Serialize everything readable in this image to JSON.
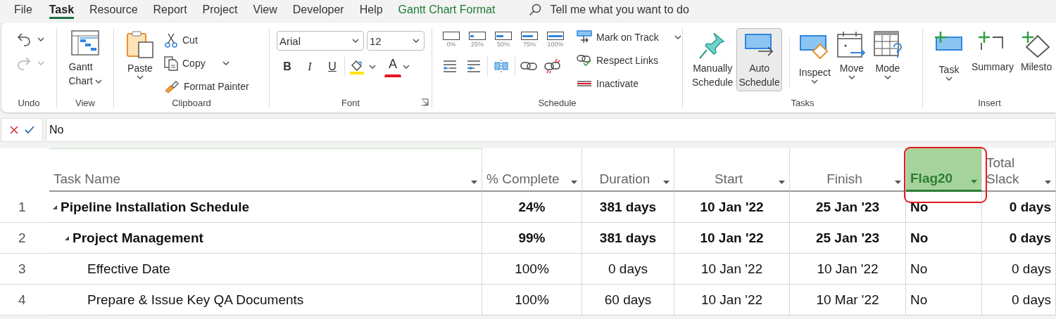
{
  "menu_tabs": [
    {
      "label": "File",
      "selected": false,
      "kind": "tab"
    },
    {
      "label": "Task",
      "selected": true,
      "kind": "tab"
    },
    {
      "label": "Resource",
      "selected": false,
      "kind": "tab"
    },
    {
      "label": "Report",
      "selected": false,
      "kind": "tab"
    },
    {
      "label": "Project",
      "selected": false,
      "kind": "tab"
    },
    {
      "label": "View",
      "selected": false,
      "kind": "tab"
    },
    {
      "label": "Developer",
      "selected": false,
      "kind": "tab"
    },
    {
      "label": "Help",
      "selected": false,
      "kind": "tab"
    },
    {
      "label": "Gantt Chart Format",
      "selected": false,
      "kind": "contextual"
    }
  ],
  "tell_me": {
    "placeholder": "Tell me what you want to do"
  },
  "ribbon": {
    "undo_group": {
      "label": "Undo",
      "undo": {
        "disabled": false
      },
      "redo": {
        "disabled": true
      }
    },
    "view_group": {
      "label": "View",
      "gantt_chart": "Gantt Chart"
    },
    "clipboard_group": {
      "label": "Clipboard",
      "paste": "Paste",
      "cut": "Cut",
      "copy": "Copy",
      "format_painter": "Format Painter"
    },
    "font_group": {
      "label": "Font",
      "font_name": "Arial",
      "font_size": "12",
      "bold": "B",
      "italic": "I",
      "underline": "U",
      "font_color": "A"
    },
    "schedule_group": {
      "label": "Schedule",
      "percent_buttons": [
        {
          "label": "0%"
        },
        {
          "label": "25%"
        },
        {
          "label": "50%"
        },
        {
          "label": "75%"
        },
        {
          "label": "100%"
        }
      ],
      "mark_on_track": "Mark on Track",
      "respect_links": "Respect Links",
      "inactivate": "Inactivate"
    },
    "tasks_group": {
      "label": "Tasks",
      "mode_buttons": [
        {
          "label": "Manually Schedule",
          "selected": false
        },
        {
          "label": "Auto Schedule",
          "selected": true
        }
      ],
      "inspect": "Inspect",
      "move": "Move",
      "mode": "Mode"
    },
    "insert_group": {
      "label": "Insert",
      "task": "Task",
      "summary": "Summary",
      "milestone": "Milesto"
    }
  },
  "formula_bar": {
    "value": "No"
  },
  "table": {
    "columns": [
      {
        "label": "Task Name",
        "selected": false,
        "annotated": false
      },
      {
        "label": "% Complete",
        "selected": false,
        "annotated": false
      },
      {
        "label": "Duration",
        "selected": false,
        "annotated": false
      },
      {
        "label": "Start",
        "selected": false,
        "annotated": false
      },
      {
        "label": "Finish",
        "selected": false,
        "annotated": false
      },
      {
        "label": "Flag20",
        "selected": true,
        "annotated": true
      },
      {
        "label": "Total Slack",
        "selected": false,
        "annotated": false
      }
    ],
    "rows": [
      {
        "number": "1",
        "summary": true,
        "expanded": true,
        "cells": [
          "Pipeline Installation Schedule",
          "24%",
          "381 days",
          "10 Jan '22",
          "25 Jan '23",
          "No",
          "0 days"
        ],
        "children": [
          {
            "number": "2",
            "summary": true,
            "expanded": true,
            "cells": [
              "Project Management",
              "99%",
              "381 days",
              "10 Jan '22",
              "25 Jan '23",
              "No",
              "0 days"
            ],
            "children": [
              {
                "number": "3",
                "summary": false,
                "cells": [
                  "Effective Date",
                  "100%",
                  "0 days",
                  "10 Jan '22",
                  "10 Jan '22",
                  "No",
                  "0 days"
                ]
              },
              {
                "number": "4",
                "summary": false,
                "cells": [
                  "Prepare & Issue Key QA Documents",
                  "100%",
                  "60 days",
                  "10 Jan '22",
                  "10 Mar '22",
                  "No",
                  "0 days"
                ]
              }
            ]
          }
        ]
      }
    ]
  }
}
